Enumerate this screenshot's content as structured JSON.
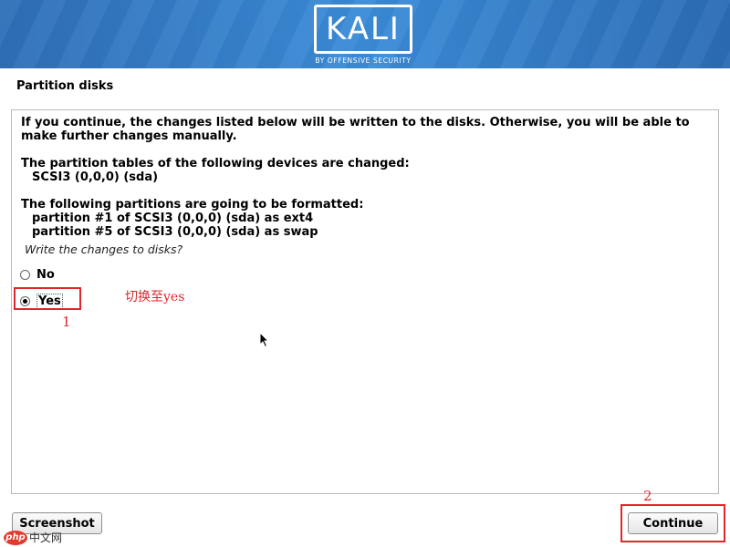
{
  "header": {
    "logo_text": "KALI",
    "logo_subtitle": "BY OFFENSIVE SECURITY"
  },
  "page": {
    "title": "Partition disks"
  },
  "main": {
    "intro": "If you continue, the changes listed below will be written to the disks. Otherwise, you will be able to make further changes manually.",
    "tables_heading": "The partition tables of the following devices are changed:",
    "tables_device": "SCSI3 (0,0,0) (sda)",
    "format_heading": "The following partitions are going to be formatted:",
    "format_items": [
      "partition #1 of SCSI3 (0,0,0) (sda) as ext4",
      "partition #5 of SCSI3 (0,0,0) (sda) as swap"
    ],
    "question": "Write the changes to disks?",
    "options": [
      {
        "label": "No",
        "selected": false
      },
      {
        "label": "Yes",
        "selected": true
      }
    ]
  },
  "annotations": {
    "note_switch": "切换至yes",
    "step_1": "1",
    "step_2": "2",
    "color": "#e0262b"
  },
  "footer": {
    "screenshot_label": "Screenshot",
    "continue_label": "Continue"
  },
  "watermark": {
    "badge": "php",
    "text": "中文网"
  },
  "colors": {
    "banner": "#3b8cd8",
    "accent": "#e0262b"
  }
}
